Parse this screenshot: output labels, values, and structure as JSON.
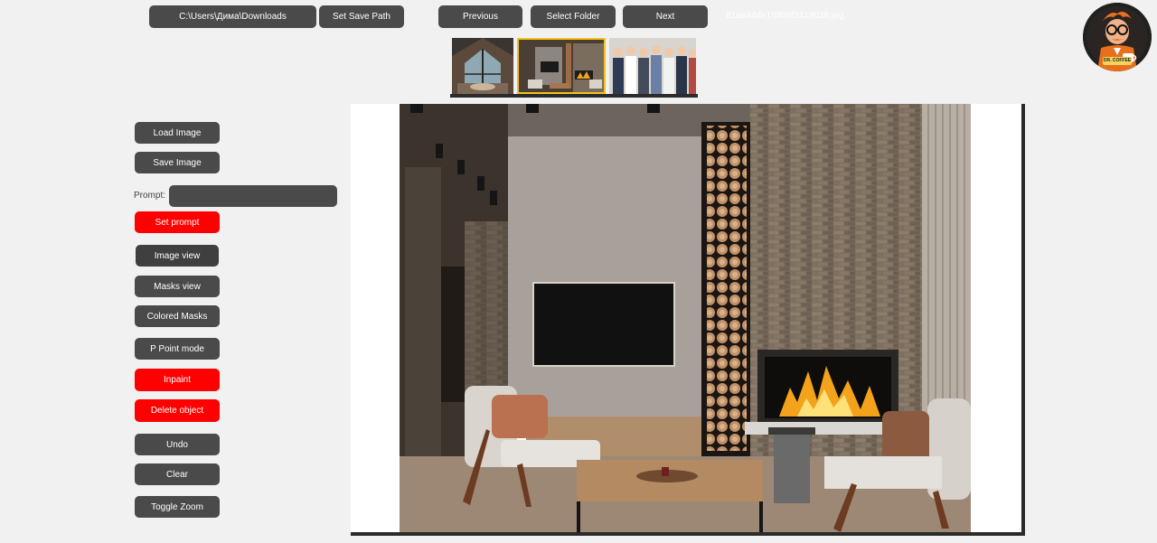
{
  "toolbar": {
    "path_label": "C:\\Users\\Дима\\Downloads",
    "set_save_path": "Set Save Path",
    "previous": "Previous",
    "select_folder": "Select Folder",
    "next": "Next",
    "filename": "81ae44de1f6f06f2419038.jpg"
  },
  "logo": {
    "text": "DR. COFFEE",
    "icon": "dr-coffee-logo"
  },
  "thumbnails": [
    {
      "name": "thumb-cabin-interior",
      "selected": false
    },
    {
      "name": "thumb-living-room-fireplace",
      "selected": true
    },
    {
      "name": "thumb-group-people",
      "selected": false
    }
  ],
  "sidebar": {
    "load_image": "Load Image",
    "save_image": "Save Image",
    "prompt_label": "Prompt:",
    "prompt_value": "",
    "set_prompt": "Set prompt",
    "image_view": "Image view",
    "masks_view": "Masks view",
    "colored_masks": "Colored Masks",
    "p_point_mode": "P Point mode",
    "inpaint": "Inpaint",
    "delete_object": "Delete object",
    "undo": "Undo",
    "clear": "Clear",
    "toggle_zoom": "Toggle Zoom"
  },
  "colors": {
    "button": "#4a4a4a",
    "button_red": "#ff0000",
    "background": "#f1f1f1",
    "selected_thumb_border": "#f2c21b"
  }
}
